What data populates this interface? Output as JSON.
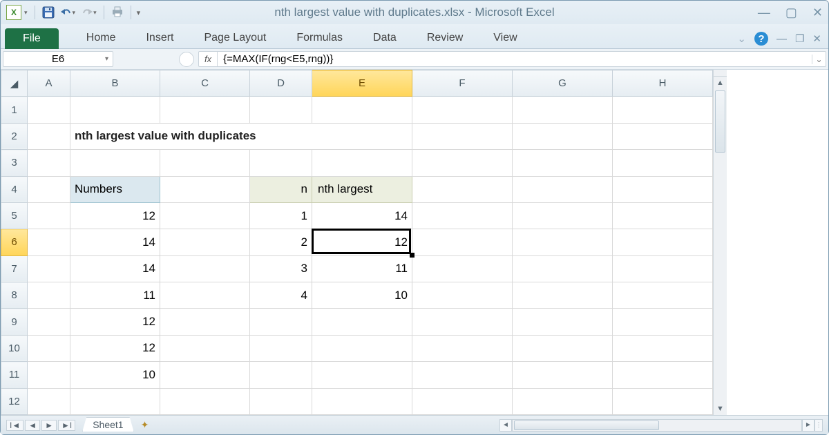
{
  "window": {
    "title": "nth largest value with duplicates.xlsx - Microsoft Excel"
  },
  "ribbon": {
    "file": "File",
    "tabs": [
      "Home",
      "Insert",
      "Page Layout",
      "Formulas",
      "Data",
      "Review",
      "View"
    ]
  },
  "namebox": "E6",
  "fx_label": "fx",
  "formula": "{=MAX(IF(rng<E5,rng))}",
  "columns": [
    "A",
    "B",
    "C",
    "D",
    "E",
    "F",
    "G",
    "H"
  ],
  "rows": [
    "1",
    "2",
    "3",
    "4",
    "5",
    "6",
    "7",
    "8",
    "9",
    "10",
    "11",
    "12"
  ],
  "selected": {
    "col": "E",
    "row": "6"
  },
  "sheet": {
    "title": "nth largest value with duplicates",
    "numbers_header": "Numbers",
    "numbers": [
      "12",
      "14",
      "14",
      "11",
      "12",
      "12",
      "10"
    ],
    "n_header": "n",
    "nth_header": "nth largest",
    "n": [
      "1",
      "2",
      "3",
      "4"
    ],
    "nth": [
      "14",
      "12",
      "11",
      "10"
    ]
  },
  "tabs": {
    "sheet1": "Sheet1"
  }
}
